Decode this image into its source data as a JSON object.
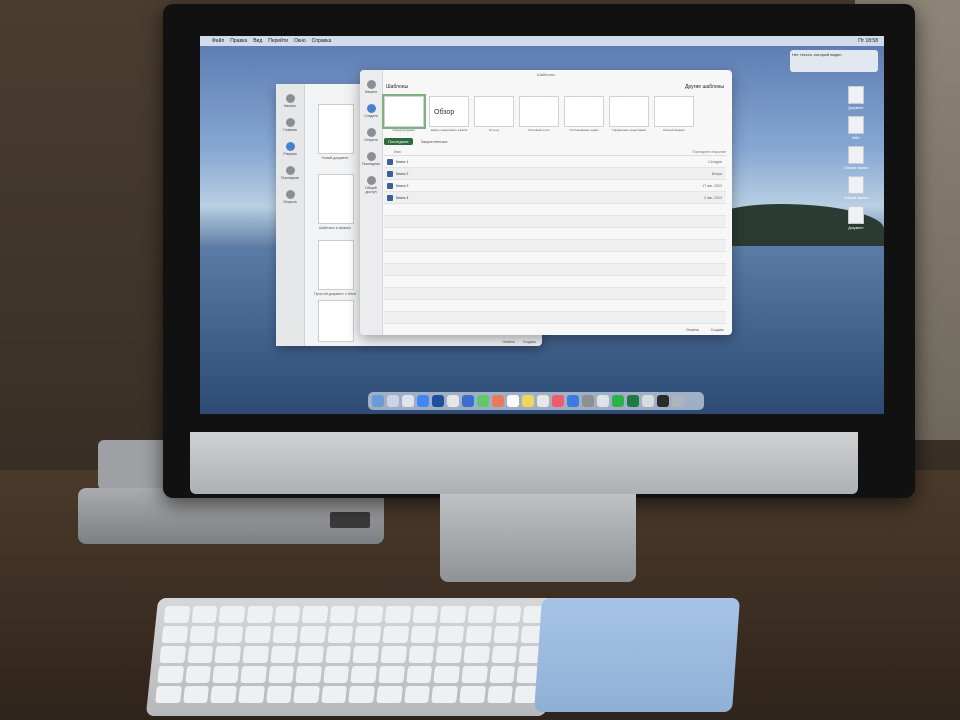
{
  "menubar": {
    "items": [
      "Файл",
      "Правка",
      "Вид",
      "Перейти",
      "Окно",
      "Справка"
    ],
    "status": "Пт 18:58"
  },
  "notification": {
    "text": "Нет текста, который виден"
  },
  "back_window": {
    "sidebar": [
      "Начало",
      "Главная",
      "Рисунки",
      "Последние",
      "Открыть"
    ],
    "captions": [
      "Новый документ",
      "Шаблоны и пример",
      "Простой документ с Word"
    ],
    "buttons": [
      "Отмена",
      "Создать"
    ]
  },
  "front_window": {
    "title": "Шаблоны",
    "header": "Шаблоны",
    "more_templates": "Другие шаблоны",
    "sidebar": [
      "Начало",
      "Создать",
      "Открыть",
      "Последние",
      "Общий доступ"
    ],
    "templates": [
      {
        "caption": "Новый документ"
      },
      {
        "caption": "Добро пожаловать в Excel",
        "overview": "Обзор"
      },
      {
        "caption": "Отчеты"
      },
      {
        "caption": "Итоговый отчет"
      },
      {
        "caption": "Отслеживание задач"
      },
      {
        "caption": "Управление средствами"
      },
      {
        "caption": "Личный бюджет"
      }
    ],
    "tabs": [
      "Последние",
      "Закрепленные"
    ],
    "columns": {
      "name": "Имя",
      "date": "Последнее открытие"
    },
    "files": [
      {
        "name": "Книга 1",
        "date": "Сегодня"
      },
      {
        "name": "Книга 2",
        "date": "Вчера"
      },
      {
        "name": "Книга 3",
        "date": "17 авг. 2023"
      },
      {
        "name": "Книга 4",
        "date": "2 авг. 2023"
      }
    ],
    "buttons": [
      "Отмена",
      "Создать"
    ]
  },
  "desktop_icons": [
    "Документ",
    "Файл",
    "Снимок экрана",
    "Снимок экрана",
    "Документ"
  ],
  "colors": {
    "accent_tab": "#2e6b3c",
    "template_selected": "#7fb07f"
  }
}
